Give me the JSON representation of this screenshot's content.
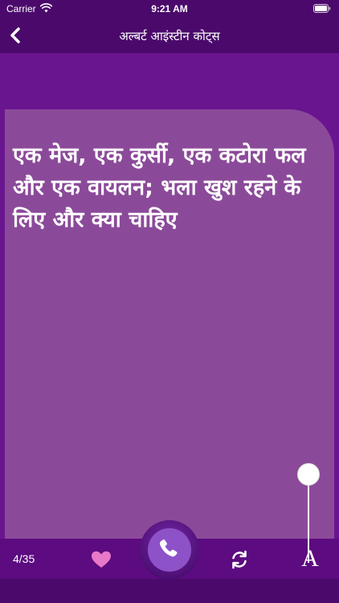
{
  "status_bar": {
    "carrier": "Carrier",
    "time": "9:21 AM"
  },
  "header": {
    "title": "अल्बर्ट आइंस्टीन कोट्स"
  },
  "quote": {
    "text": "एक मेज, एक कुर्सी, एक कटोरा फल और एक वायलन; भला खुश रहने के लिए और क्या चाहिए"
  },
  "footer": {
    "counter": "4/35",
    "font_label": "A"
  },
  "icons": {
    "back": "chevron-left-icon",
    "wifi": "wifi-icon",
    "battery": "battery-icon",
    "favorite": "heart-icon",
    "call": "phone-icon",
    "refresh": "refresh-icon",
    "font": "font-size-icon"
  },
  "colors": {
    "nav_background": "#4b0a6b",
    "content_background": "#6a1590",
    "card_background": "#8b4a99",
    "heart": "#e879c8",
    "call_button": "#8e52c8"
  },
  "slider": {
    "font_size_level": 1.0
  }
}
